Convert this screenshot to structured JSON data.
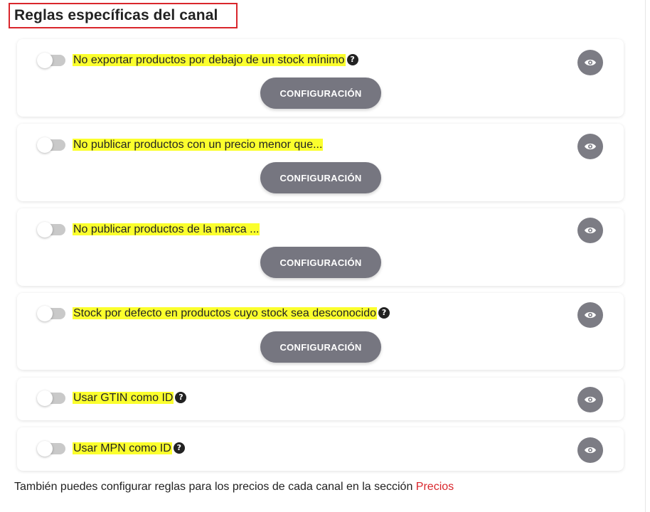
{
  "section": {
    "title": "Reglas específicas del canal"
  },
  "rules": [
    {
      "label": "No exportar productos por debajo de un stock mínimo",
      "has_help": true,
      "config_label": "CONFIGURACIÓN",
      "enabled": false
    },
    {
      "label": "No publicar productos con un precio menor que...",
      "has_help": false,
      "config_label": "CONFIGURACIÓN",
      "enabled": false
    },
    {
      "label": "No publicar productos de la marca ...",
      "has_help": false,
      "config_label": "CONFIGURACIÓN",
      "enabled": false
    },
    {
      "label": "Stock por defecto en productos cuyo stock sea desconocido",
      "has_help": true,
      "config_label": "CONFIGURACIÓN",
      "enabled": false
    },
    {
      "label": "Usar GTIN como ID",
      "has_help": true,
      "enabled": false
    },
    {
      "label": "Usar MPN como ID",
      "has_help": true,
      "enabled": false
    }
  ],
  "help_glyph": "?",
  "footer": {
    "text": "También puedes configurar reglas para los precios de cada canal en la sección",
    "link": "Precios"
  },
  "colors": {
    "highlight": "#fbff2d",
    "annotation_box": "#d9262c",
    "button": "#767680",
    "link": "#d9262c"
  },
  "icons": {
    "toggle": "toggle-switch-icon",
    "eye": "eye-icon",
    "help": "question-circle-icon"
  }
}
